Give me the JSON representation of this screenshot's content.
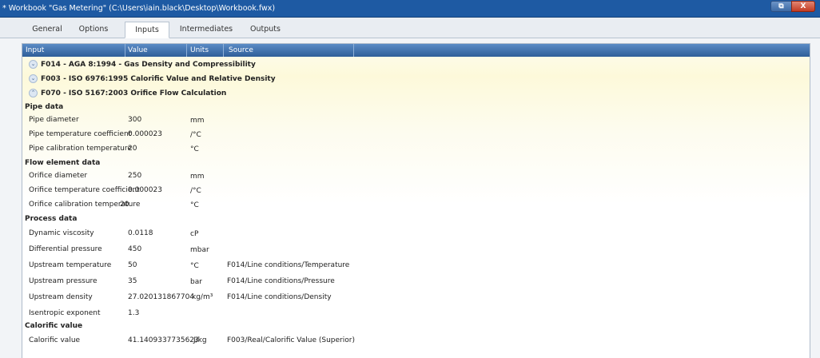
{
  "window": {
    "title": "* Workbook \"Gas Metering\" (C:\\Users\\iain.black\\Desktop\\Workbook.fwx)",
    "restore_glyph": "⧉",
    "close_glyph": "X"
  },
  "tabs": [
    {
      "label": "General",
      "active": false
    },
    {
      "label": "Options",
      "active": false
    },
    {
      "label": "Inputs",
      "active": true
    },
    {
      "label": "Intermediates",
      "active": false
    },
    {
      "label": "Outputs",
      "active": false
    }
  ],
  "grid": {
    "columns": [
      "Input",
      "Value",
      "Units",
      "Source"
    ],
    "groups": [
      {
        "glyph": "⌄",
        "label": "F014 - AGA 8:1994 - Gas Density and Compressibility",
        "expanded": false
      },
      {
        "glyph": "⌄",
        "label": "F003 - ISO 6976:1995 Calorific Value and Relative Density",
        "expanded": false
      },
      {
        "glyph": "⌃",
        "label": "F070 - ISO 5167:2003 Orifice Flow Calculation",
        "expanded": true
      }
    ],
    "sections": [
      {
        "title": "Pipe data",
        "rows": [
          {
            "name": "Pipe diameter",
            "value": "300",
            "units": "mm",
            "source": ""
          },
          {
            "name": "Pipe temperature coefficient",
            "value": "0.000023",
            "units": "/°C",
            "source": ""
          },
          {
            "name": "Pipe calibration temperature",
            "value": "20",
            "units": "°C",
            "source": ""
          }
        ]
      },
      {
        "title": "Flow element data",
        "rows": [
          {
            "name": "Orifice diameter",
            "value": "250",
            "units": "mm",
            "source": ""
          },
          {
            "name": "Orifice temperature coefficient",
            "value": "0.000023",
            "units": "/°C",
            "source": ""
          },
          {
            "name": "Orifice calibration temperature",
            "value": "20",
            "units": "°C",
            "source": ""
          }
        ]
      },
      {
        "title": "Process data",
        "rows": [
          {
            "name": "Dynamic viscosity",
            "value": "0.0118",
            "units": "cP",
            "source": ""
          },
          {
            "name": "Differential pressure",
            "value": "450",
            "units": "mbar",
            "source": ""
          },
          {
            "name": "Upstream temperature",
            "value": "50",
            "units": "°C",
            "source": "F014/Line conditions/Temperature"
          },
          {
            "name": "Upstream pressure",
            "value": "35",
            "units": "bar",
            "source": "F014/Line conditions/Pressure"
          },
          {
            "name": "Upstream density",
            "value": "27.020131867704",
            "units": "kg/m³",
            "source": "F014/Line conditions/Density"
          },
          {
            "name": "Isentropic exponent",
            "value": "1.3",
            "units": "",
            "source": ""
          }
        ]
      },
      {
        "title": "Calorific value",
        "rows": [
          {
            "name": "Calorific value",
            "value": "41.1409337735623",
            "units": "J/kg",
            "source": "F003/Real/Calorific Value (Superior)"
          }
        ]
      }
    ]
  }
}
